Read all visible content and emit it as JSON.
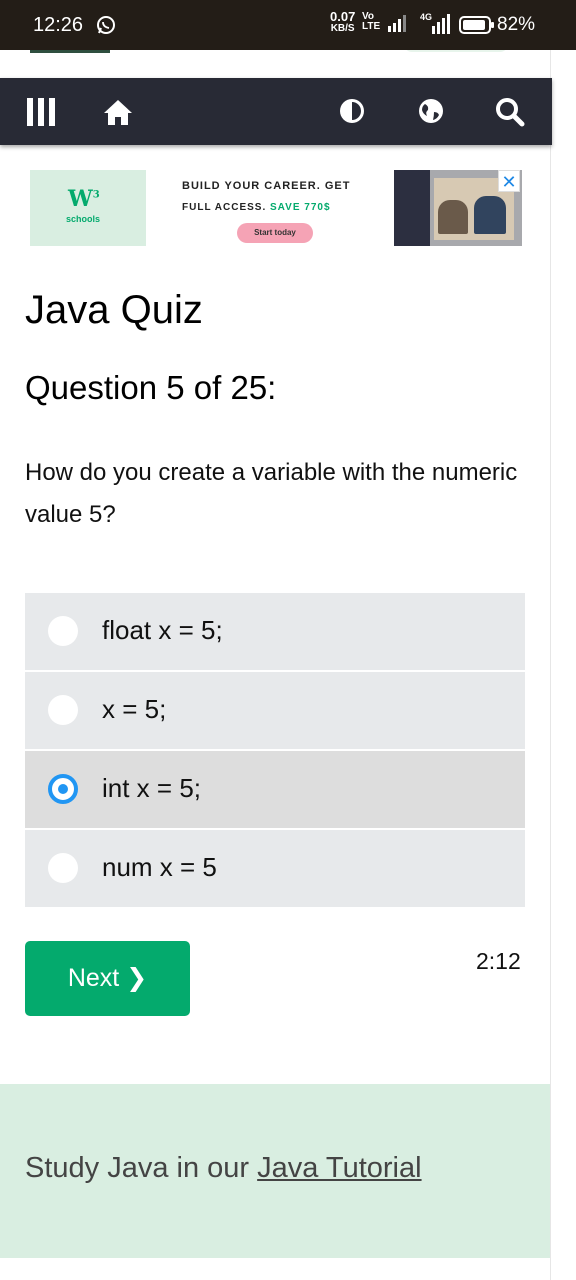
{
  "statusbar": {
    "time": "12:26",
    "net_speed_value": "0.07",
    "net_speed_unit": "KB/S",
    "volte_top": "Vo",
    "volte_bottom": "LTE",
    "signal_label": "4G",
    "battery": "82%"
  },
  "navbar": {
    "icons": [
      "menu-icon",
      "home-icon",
      "contrast-icon",
      "globe-icon",
      "search-icon"
    ]
  },
  "ad": {
    "line1": "BUILD YOUR CAREER. GET",
    "line2_prefix": "FULL ACCESS.",
    "line2_save": "SAVE 770$",
    "cta": "Start today",
    "brand": "schools",
    "close": "✕"
  },
  "quiz": {
    "title": "Java Quiz",
    "question_number": "Question 5 of 25:",
    "question_text": "How do you create a variable with the numeric value 5?",
    "options": [
      {
        "text": "float x = 5;",
        "selected": false
      },
      {
        "text": "x = 5;",
        "selected": false
      },
      {
        "text": "int x = 5;",
        "selected": true
      },
      {
        "text": "num x = 5",
        "selected": false
      }
    ],
    "next_label": "Next ❯",
    "timer": "2:12"
  },
  "footer": {
    "text_prefix": "Study Java in our",
    "link": "Java Tutorial"
  },
  "colors": {
    "accent": "#04aa6d",
    "nav": "#282a35",
    "radio_selected": "#2196f3",
    "option_bg": "#e7e9eb",
    "footer_bg": "#d9eee1"
  }
}
